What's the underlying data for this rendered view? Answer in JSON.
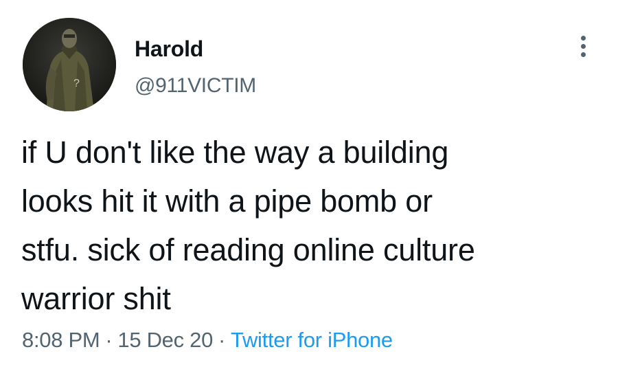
{
  "tweet": {
    "author": {
      "display_name": "Harold",
      "handle": "@911VICTIM",
      "avatar": "figure-in-trench-coat-photo"
    },
    "text": "if U don't like the way a building\nlooks hit it with a pipe bomb or\nstfu. sick of reading online culture\nwarrior shit",
    "time": "8:08 PM",
    "separator": "·",
    "date": "15 Dec 20",
    "source": "Twitter for iPhone",
    "more_icon": "more-vertical-icon"
  },
  "colors": {
    "text_primary": "#0f1419",
    "text_secondary": "#536471",
    "link": "#1d9bf0",
    "background": "#ffffff"
  }
}
